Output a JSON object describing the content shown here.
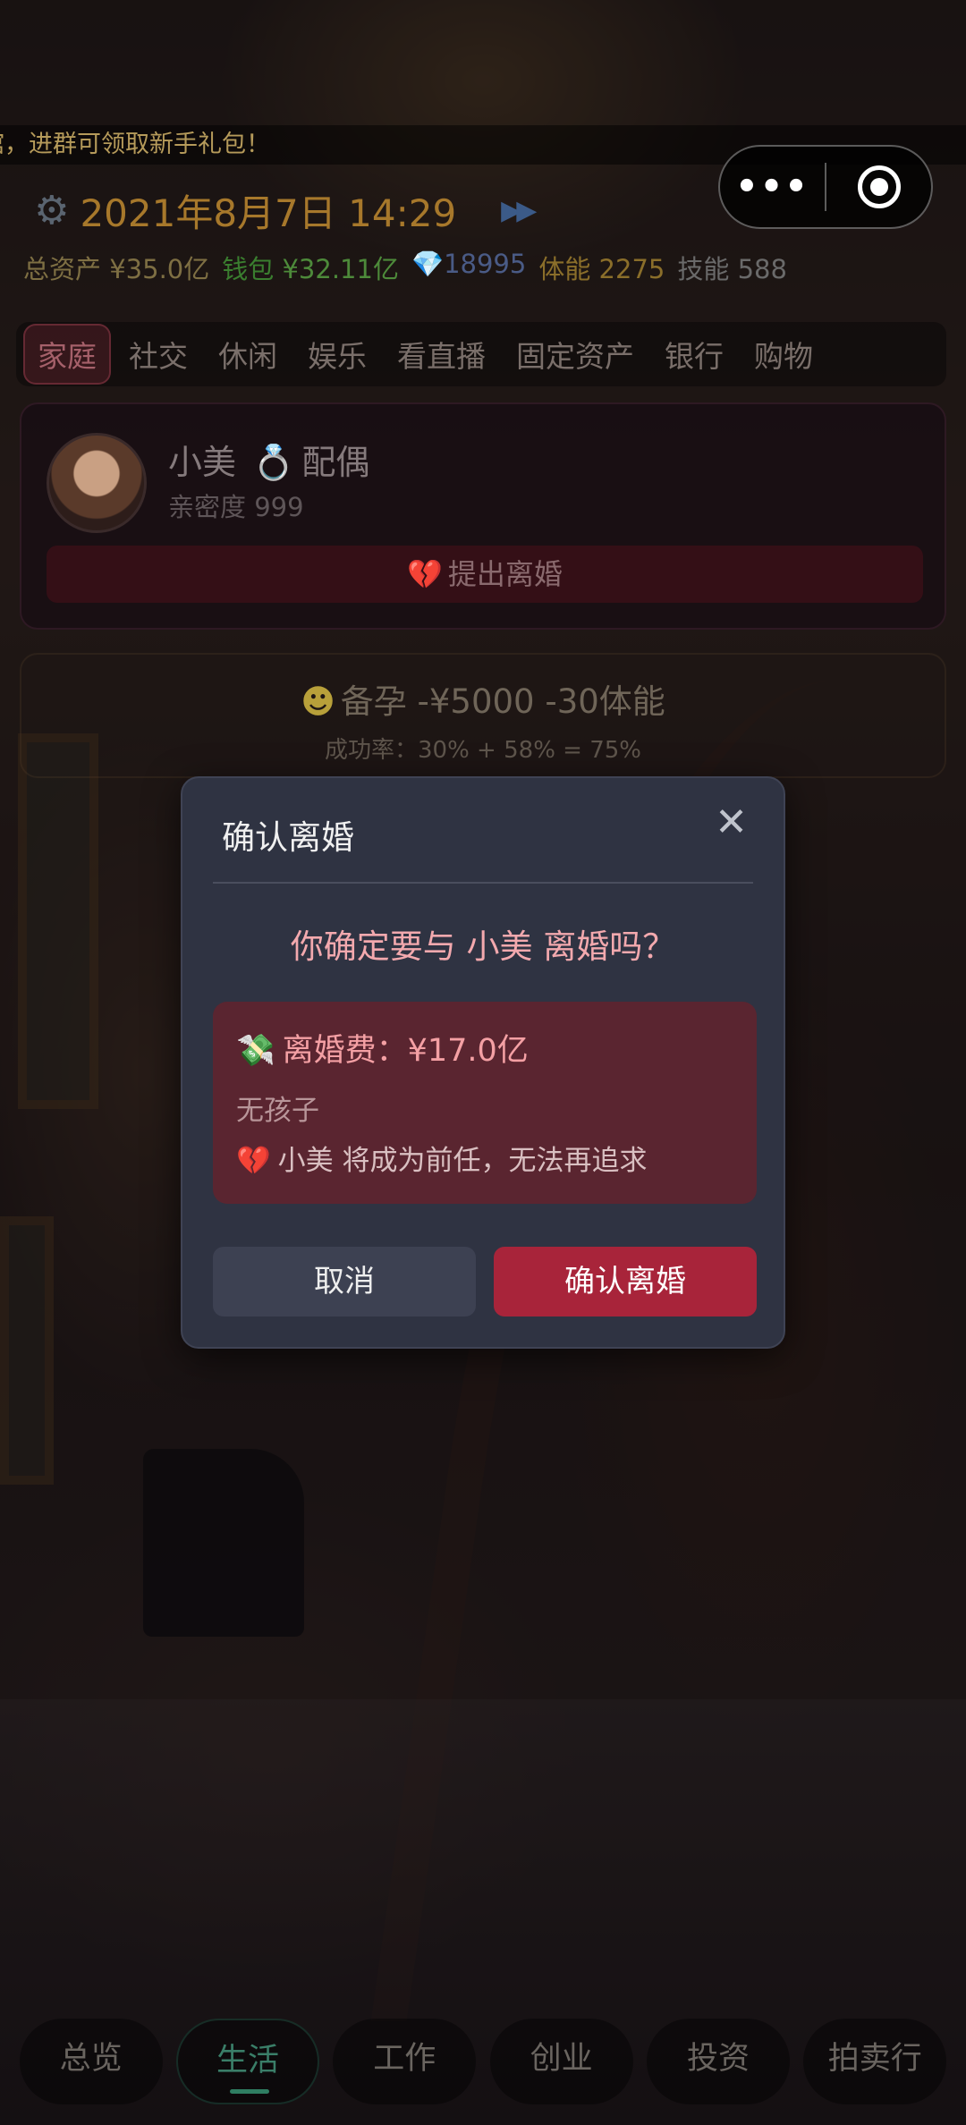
{
  "ticker": {
    "text": "馆，进群可领取新手礼包！"
  },
  "header": {
    "datetime": "2021年8月7日 14:29",
    "speed_icon": "fast-forward-icon",
    "gear_icon": "gear-icon"
  },
  "stats": {
    "assets": "总资产 ¥35.0亿",
    "wallet_label": "钱包",
    "wallet_value": "¥32.11亿",
    "gems": "18995",
    "stamina": "体能 2275",
    "skill": "技能 588"
  },
  "capsule": {
    "more_label": "•••"
  },
  "categories": {
    "items": [
      "家庭",
      "社交",
      "休闲",
      "娱乐",
      "看直播",
      "固定资产",
      "银行",
      "购物"
    ],
    "active": "家庭"
  },
  "spouse": {
    "name": "小美",
    "role": "配偶",
    "intimacy": "亲密度 999",
    "divorce_button": "提出离婚"
  },
  "pregnancy": {
    "title": "备孕  -¥5000  -30体能",
    "rate": "成功率：30% + 58% = 75%"
  },
  "bottom_nav": {
    "items": [
      "总览",
      "生活",
      "工作",
      "创业",
      "投资",
      "拍卖行"
    ],
    "active": "生活"
  },
  "modal": {
    "title": "确认离婚",
    "close_icon": "close-icon",
    "question": "你确定要与 小美 离婚吗？",
    "fee": "离婚费：¥17.0亿",
    "children": "无孩子",
    "ex_note": "小美 将成为前任，无法再追求",
    "cancel_label": "取消",
    "confirm_label": "确认离婚"
  },
  "colors": {
    "modal_bg": "#2f3342",
    "warn_bg": "#5a2530",
    "confirm_bg": "#a8243a",
    "accent_pink": "#f3a9ae"
  }
}
